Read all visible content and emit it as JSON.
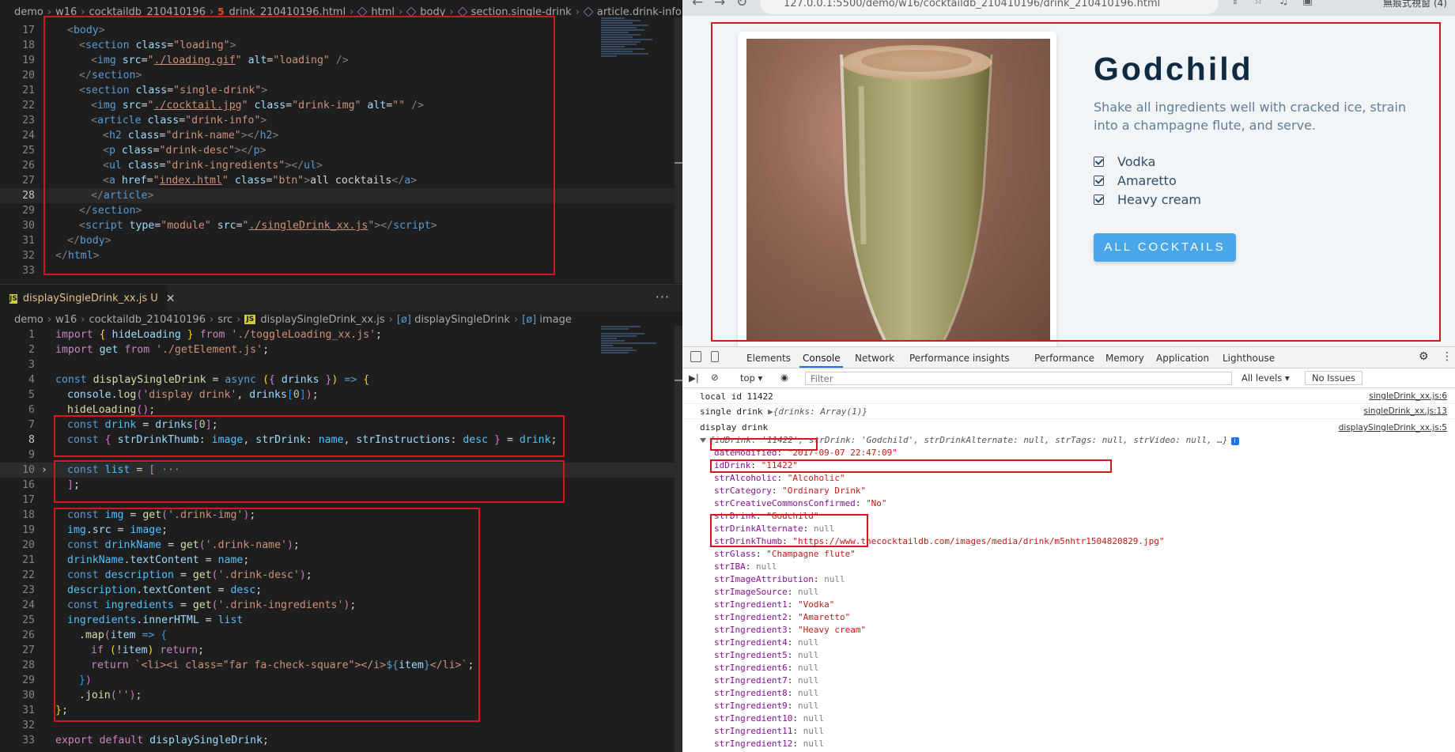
{
  "editor": {
    "breadcrumb_top": [
      "demo",
      "w16",
      "cocktaildb_210410196",
      "drink_210410196.html",
      "html",
      "body",
      "section.single-drink",
      "article.drink-info"
    ],
    "tab_label": "displaySingleDrink_xx.js",
    "tab_status": "U",
    "tab_more": "···",
    "breadcrumb_bottom": [
      "demo",
      "w16",
      "cocktaildb_210410196",
      "src",
      "displaySingleDrink_xx.js",
      "displaySingleDrink",
      "image"
    ],
    "html_lines": [
      {
        "n": "17"
      },
      {
        "n": "18"
      },
      {
        "n": "19"
      },
      {
        "n": "20"
      },
      {
        "n": "21"
      },
      {
        "n": "22"
      },
      {
        "n": "23"
      },
      {
        "n": "24"
      },
      {
        "n": "25"
      },
      {
        "n": "26"
      },
      {
        "n": "27"
      },
      {
        "n": "28"
      },
      {
        "n": "29"
      },
      {
        "n": "30"
      },
      {
        "n": "31"
      },
      {
        "n": "32"
      },
      {
        "n": "33"
      }
    ],
    "js_lines": [
      {
        "n": "1"
      },
      {
        "n": "2"
      },
      {
        "n": "3"
      },
      {
        "n": "4"
      },
      {
        "n": "5"
      },
      {
        "n": "6"
      },
      {
        "n": "7"
      },
      {
        "n": "8"
      },
      {
        "n": "9"
      },
      {
        "n": "10"
      },
      {
        "n": "16"
      },
      {
        "n": "17"
      },
      {
        "n": "18"
      },
      {
        "n": "19"
      },
      {
        "n": "20"
      },
      {
        "n": "21"
      },
      {
        "n": "22"
      },
      {
        "n": "23"
      },
      {
        "n": "24"
      },
      {
        "n": "25"
      },
      {
        "n": "26"
      },
      {
        "n": "27"
      },
      {
        "n": "28"
      },
      {
        "n": "29"
      },
      {
        "n": "30"
      },
      {
        "n": "31"
      },
      {
        "n": "32"
      },
      {
        "n": "33"
      }
    ]
  },
  "browser": {
    "url": "127.0.0.1:5500/demo/w16/cocktaildb_210410196/drink_210410196.html",
    "profile": "無痕式視窗 (4)",
    "drink": {
      "name": "Godchild",
      "description": "Shake all ingredients well with cracked ice, strain into a champagne flute, and serve.",
      "ingredients": [
        "Vodka",
        "Amaretto",
        "Heavy cream"
      ],
      "button": "ALL COCKTAILS"
    }
  },
  "devtools": {
    "tabs": [
      "Elements",
      "Console",
      "Network",
      "Performance insights",
      "Performance",
      "Memory",
      "Application",
      "Lighthouse"
    ],
    "context": "top",
    "filter_placeholder": "Filter",
    "levels": "All levels",
    "issues": "No Issues",
    "console": {
      "local_id": "local id 11422",
      "local_id_src": "singleDrink_xx.js:6",
      "single_drink": "single drink",
      "single_drink_obj": "{drinks: Array(1)}",
      "single_drink_src": "singleDrink_xx.js:13",
      "display_drink": "display drink",
      "display_drink_src": "displaySingleDrink_xx.js:5",
      "summary": "{idDrink: '11422', strDrink: 'Godchild', strDrinkAlternate: null, strTags: null, strVideo: null, …}",
      "props": [
        {
          "k": "dateModified",
          "v": "\"2017-09-07 22:47:09\"",
          "t": "s"
        },
        {
          "k": "idDrink",
          "v": "\"11422\"",
          "t": "s"
        },
        {
          "k": "strAlcoholic",
          "v": "\"Alcoholic\"",
          "t": "s"
        },
        {
          "k": "strCategory",
          "v": "\"Ordinary Drink\"",
          "t": "s"
        },
        {
          "k": "strCreativeCommonsConfirmed",
          "v": "\"No\"",
          "t": "s"
        },
        {
          "k": "strDrink",
          "v": "\"Godchild\"",
          "t": "s"
        },
        {
          "k": "strDrinkAlternate",
          "v": "null",
          "t": "n"
        },
        {
          "k": "strDrinkThumb",
          "v": "\"https://www.thecocktaildb.com/images/media/drink/m5nhtr1504820829.jpg\"",
          "t": "s"
        },
        {
          "k": "strGlass",
          "v": "\"Champagne flute\"",
          "t": "s"
        },
        {
          "k": "strIBA",
          "v": "null",
          "t": "n"
        },
        {
          "k": "strImageAttribution",
          "v": "null",
          "t": "n"
        },
        {
          "k": "strImageSource",
          "v": "null",
          "t": "n"
        },
        {
          "k": "strIngredient1",
          "v": "\"Vodka\"",
          "t": "s"
        },
        {
          "k": "strIngredient2",
          "v": "\"Amaretto\"",
          "t": "s"
        },
        {
          "k": "strIngredient3",
          "v": "\"Heavy cream\"",
          "t": "s"
        },
        {
          "k": "strIngredient4",
          "v": "null",
          "t": "n"
        },
        {
          "k": "strIngredient5",
          "v": "null",
          "t": "n"
        },
        {
          "k": "strIngredient6",
          "v": "null",
          "t": "n"
        },
        {
          "k": "strIngredient7",
          "v": "null",
          "t": "n"
        },
        {
          "k": "strIngredient8",
          "v": "null",
          "t": "n"
        },
        {
          "k": "strIngredient9",
          "v": "null",
          "t": "n"
        },
        {
          "k": "strIngredient10",
          "v": "null",
          "t": "n"
        },
        {
          "k": "strIngredient11",
          "v": "null",
          "t": "n"
        },
        {
          "k": "strIngredient12",
          "v": "null",
          "t": "n"
        }
      ]
    }
  },
  "colors": {
    "accent": "#49a6e9",
    "highlight_box": "#d01820",
    "title": "#102a42"
  }
}
